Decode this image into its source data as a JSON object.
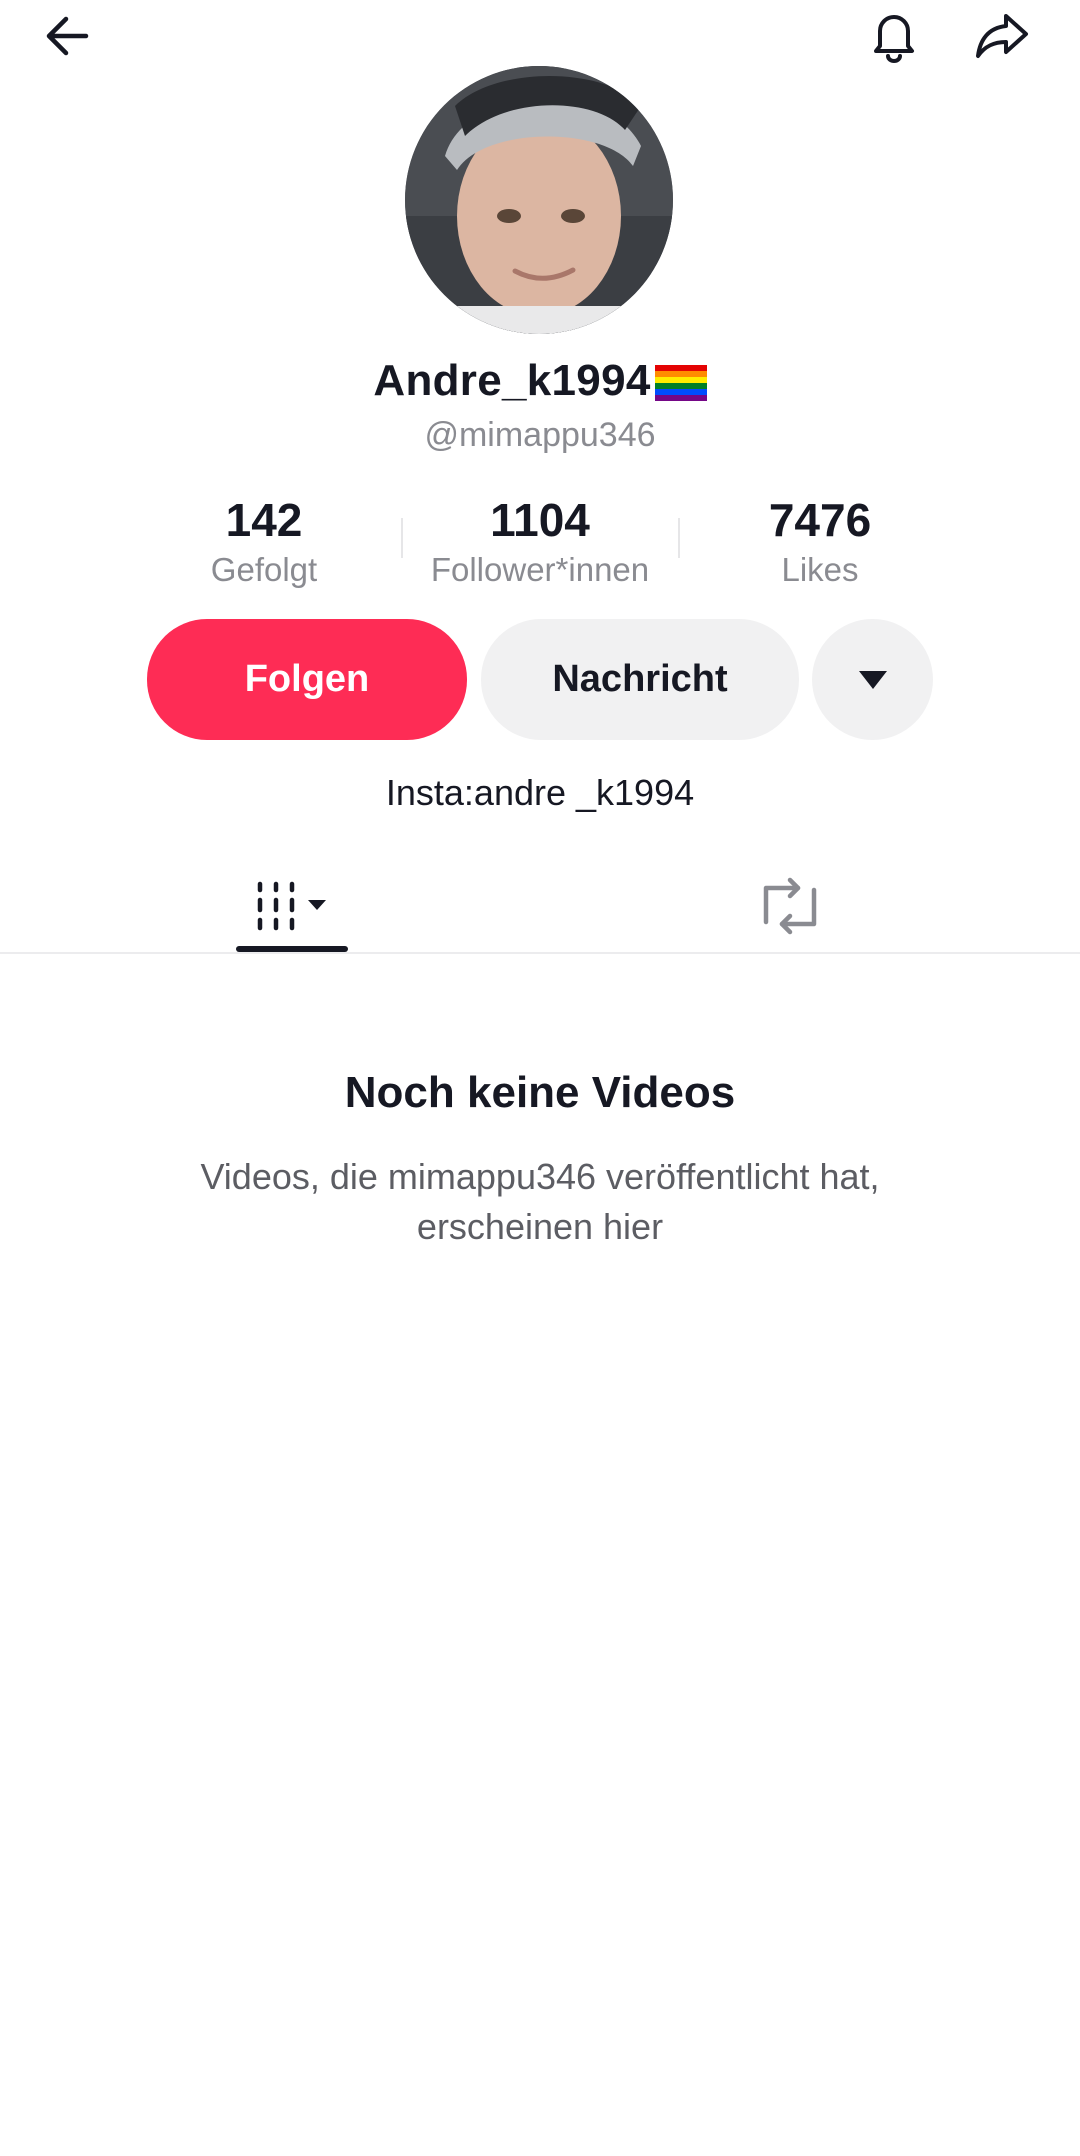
{
  "header": {
    "back_icon": "arrow-left-icon",
    "notification_icon": "bell-icon",
    "share_icon": "share-arrow-icon"
  },
  "profile": {
    "display_name": "Andre_k1994",
    "handle": "@mimappu346",
    "bio": "Insta:andre _k1994"
  },
  "stats": [
    {
      "value": "142",
      "label": "Gefolgt"
    },
    {
      "value": "1104",
      "label": "Follower*innen"
    },
    {
      "value": "7476",
      "label": "Likes"
    }
  ],
  "actions": {
    "follow_label": "Folgen",
    "message_label": "Nachricht",
    "more_icon": "caret-down-icon"
  },
  "tabs": {
    "videos_icon": "grid-columns-icon",
    "reposts_icon": "repost-icon"
  },
  "empty_state": {
    "title": "Noch keine Videos",
    "description": "Videos, die mimappu346 veröffentlicht hat, erscheinen hier"
  },
  "colors": {
    "accent": "#fe2c55",
    "secondary_button": "#f1f1f2",
    "text": "#161823",
    "muted": "#8a8b91"
  }
}
